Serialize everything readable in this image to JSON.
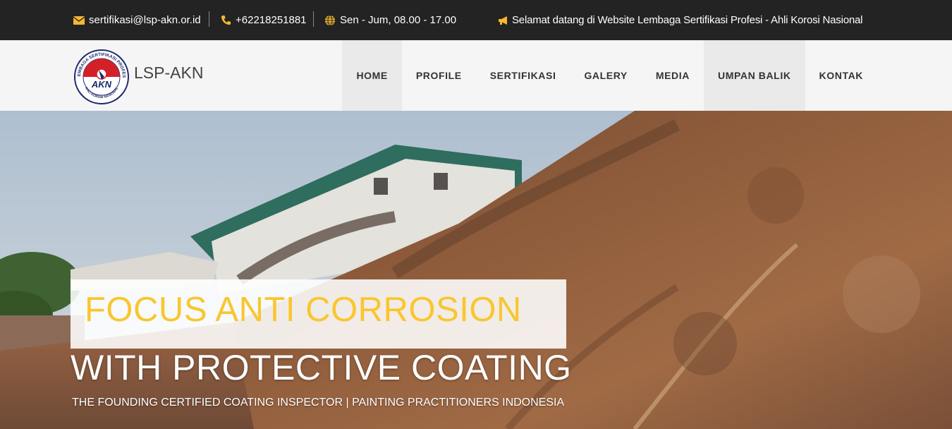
{
  "topbar": {
    "email": "sertifikasi@lsp-akn.or.id",
    "phone": "+62218251881",
    "hours": "Sen - Jum, 08.00 - 17.00",
    "announcement": "Selamat datang di Website Lembaga Sertifikasi Profesi - Ahli Korosi Nasional",
    "icons": [
      "envelope-icon",
      "phone-icon",
      "globe-icon",
      "megaphone-icon"
    ],
    "icon_color": "#f5b82e"
  },
  "header": {
    "brand_name": "LSP-AKN",
    "logo": {
      "ring_text_top": "LEMBAGA SERTIFIKASI PROFESI",
      "ring_text_bottom": "AHLI KOROSI NASIONAL",
      "center_text": "AKN"
    }
  },
  "nav": {
    "items": [
      {
        "label": "HOME"
      },
      {
        "label": "PROFILE"
      },
      {
        "label": "SERTIFIKASI"
      },
      {
        "label": "GALERY"
      },
      {
        "label": "MEDIA"
      },
      {
        "label": "UMPAN BALIK"
      },
      {
        "label": "KONTAK"
      }
    ],
    "active_label": "HOME"
  },
  "hero": {
    "headline_1": "FOCUS ANTI CORROSION",
    "headline_2": "WITH PROTECTIVE COATING",
    "subtitle": "THE FOUNDING CERTIFIED COATING INSPECTOR | PAINTING PRACTITIONERS INDONESIA",
    "accent_color": "#f8c72e"
  }
}
